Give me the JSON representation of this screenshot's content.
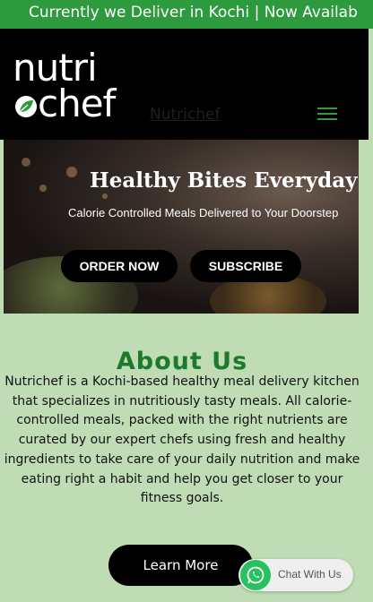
{
  "ticker": {
    "text": "Currently we Deliver in Kochi | Now Availab"
  },
  "header": {
    "logo_line1": "nutri",
    "logo_line2": "chef",
    "site_link": "Nutrichef",
    "menu_icon": "hamburger-icon",
    "accent": "#2e9a3e"
  },
  "hero": {
    "title": "Healthy Bites Everyday!",
    "subtitle": "Calorie Controlled Meals Delivered to Your Doorstep",
    "order_label": "ORDER NOW",
    "subscribe_label": "SUBSCRIBE"
  },
  "about": {
    "title": "About Us",
    "lines": [
      "Nutrichef is a Kochi-based healthy meal delivery kitchen",
      "that specializes in nutritiously tasty meals. All calorie-",
      "controlled meals, packed with the right nutrients are",
      "curated by our expert chefs using fresh and healthy",
      "ingredients to take care of your daily nutrition and make",
      "eating right a habit and help you get closer to your",
      "fitness goals."
    ],
    "learn_more_label": "Learn More",
    "title_color": "#1d7a2c"
  },
  "chat": {
    "label": "Chat With Us",
    "icon": "whatsapp-icon"
  }
}
